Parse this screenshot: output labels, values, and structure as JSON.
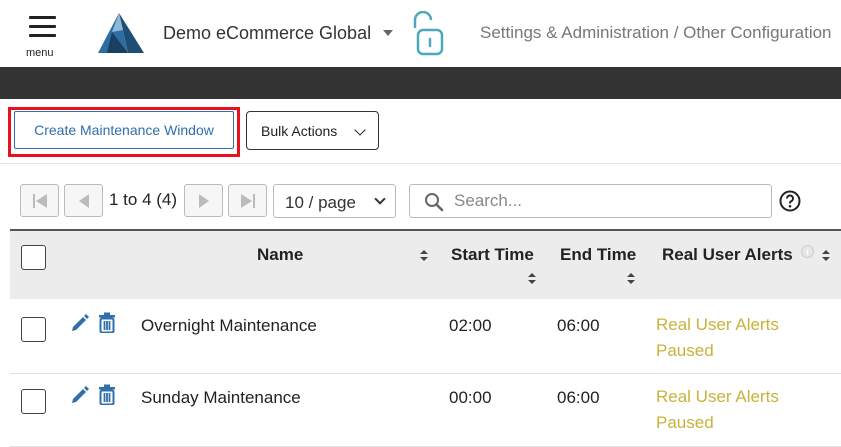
{
  "header": {
    "menu_label": "menu",
    "org_name": "Demo eCommerce Global",
    "breadcrumb": "Settings & Administration / Other Configuration"
  },
  "actions": {
    "create_label": "Create Maintenance Window",
    "bulk_label": "Bulk Actions"
  },
  "pagination": {
    "range_text": "1 to 4 (4)",
    "per_page": "10 / page"
  },
  "search": {
    "placeholder": "Search..."
  },
  "table": {
    "columns": [
      "Name",
      "Start Time",
      "End Time",
      "Real User Alerts"
    ],
    "rows": [
      {
        "name": "Overnight Maintenance",
        "start": "02:00",
        "end": "06:00",
        "alert": "Real User Alerts Paused"
      },
      {
        "name": "Sunday Maintenance",
        "start": "00:00",
        "end": "06:00",
        "alert": "Real User Alerts Paused"
      }
    ]
  },
  "colors": {
    "accent_blue": "#2f6fab",
    "highlight_red": "#e8121e",
    "alert_yellow": "#c9b23a",
    "dark_bar": "#333333"
  },
  "icons": [
    "menu-icon",
    "logo-icon",
    "lock-open-icon",
    "first-page-icon",
    "prev-page-icon",
    "next-page-icon",
    "last-page-icon",
    "search-icon",
    "help-icon",
    "info-icon",
    "edit-icon",
    "delete-icon"
  ]
}
